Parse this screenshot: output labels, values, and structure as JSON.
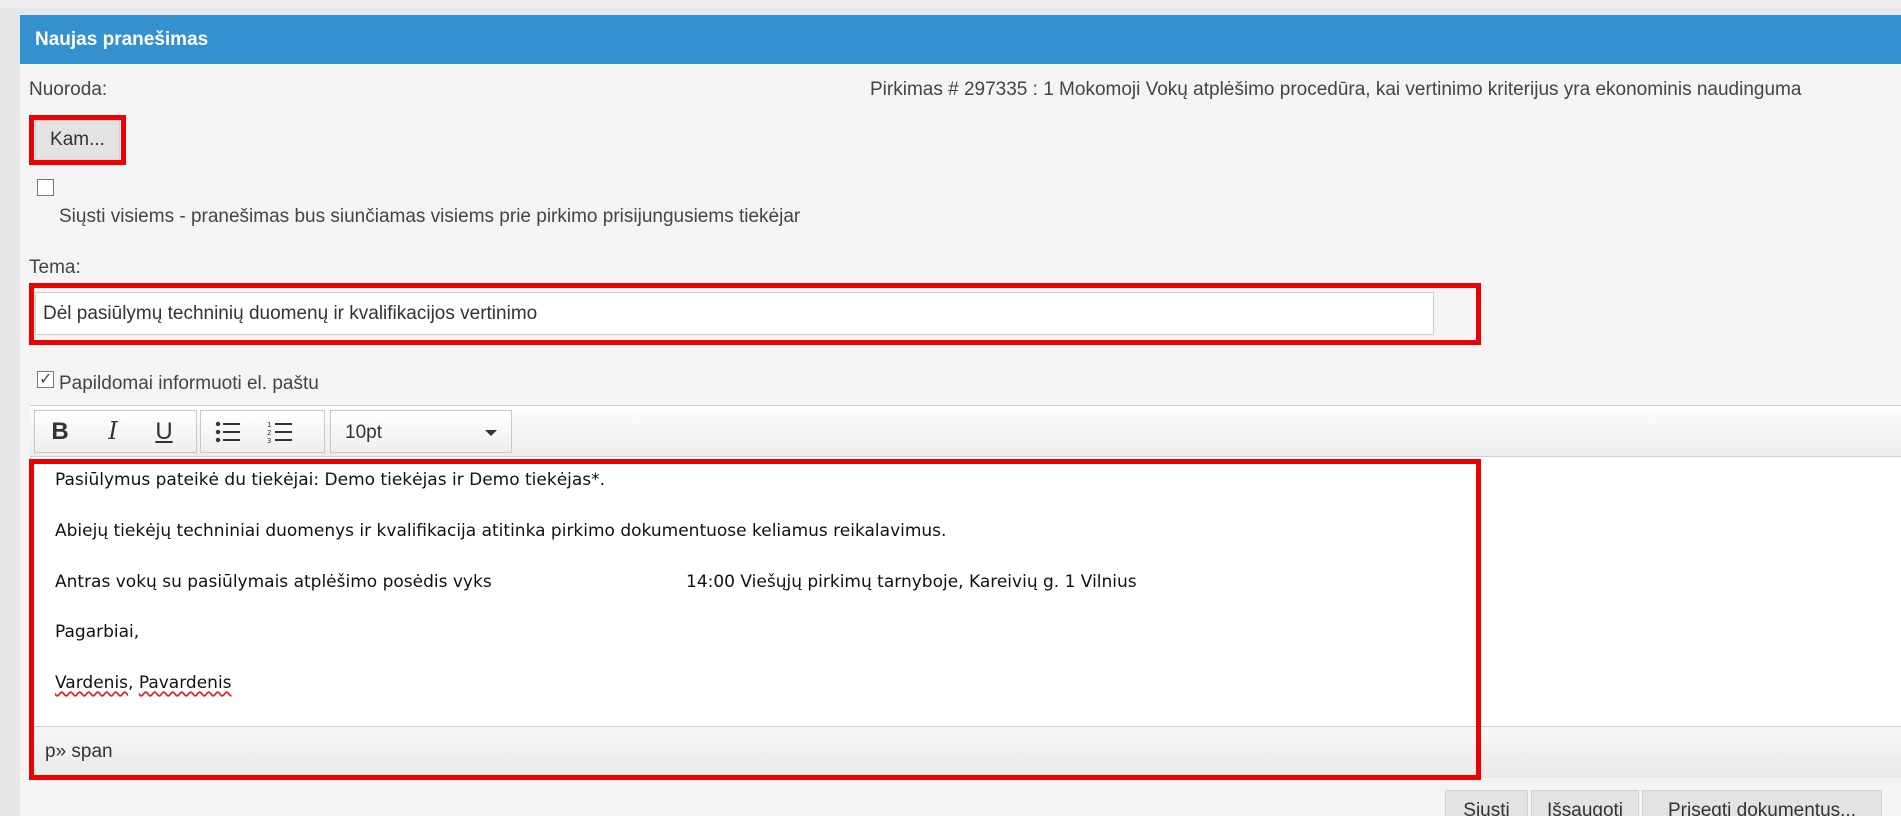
{
  "dialog": {
    "title": "Naujas pranešimas"
  },
  "reference": {
    "label": "Nuoroda:",
    "value": "Pirkimas  # 297335 :  1   Mokomoji Vokų atplėšimo procedūra, kai vertinimo kriterijus yra ekonominis naudinguma"
  },
  "recipients": {
    "button_label": "Kam..."
  },
  "send_all": {
    "checked": false,
    "label": "Siųsti visiems - pranešimas bus siunčiamas visiems prie pirkimo prisijungusiems tiekėjar"
  },
  "subject": {
    "label": "Tema:",
    "value": "Dėl pasiūlymų techninių duomenų ir kvalifikacijos vertinimo"
  },
  "email_notify": {
    "checked": true,
    "label": "Papildomai informuoti el. paštu"
  },
  "toolbar": {
    "bold": "B",
    "italic": "I",
    "underline": "U",
    "font_size": "10pt"
  },
  "editor": {
    "line1": "Pasiūlymus pateikė du tiekėjai: Demo tiekėjas ir Demo tiekėjas*.",
    "line2": "Abiejų tiekėjų techniniai duomenys ir kvalifikacija atitinka pirkimo dokumentuose keliamus reikalavimus.",
    "line3_start": "Antras vokų su pasiūlymais atplėšimo posėdis vyks",
    "line3_end": "14:00 Viešųjų pirkimų tarnyboje, Kareivių g. 1 Vilnius",
    "line4": "Pagarbiai,",
    "line5_first": "Vardenis",
    "line5_sep": ", ",
    "line5_last": "Pavardenis",
    "status_path": "p» span"
  },
  "actions": {
    "send": "Siųsti",
    "save": "Išsaugoti",
    "attach": "Prisegti dokumentus..."
  },
  "colors": {
    "titlebar": "#3391d0",
    "highlight": "#ee0000"
  }
}
